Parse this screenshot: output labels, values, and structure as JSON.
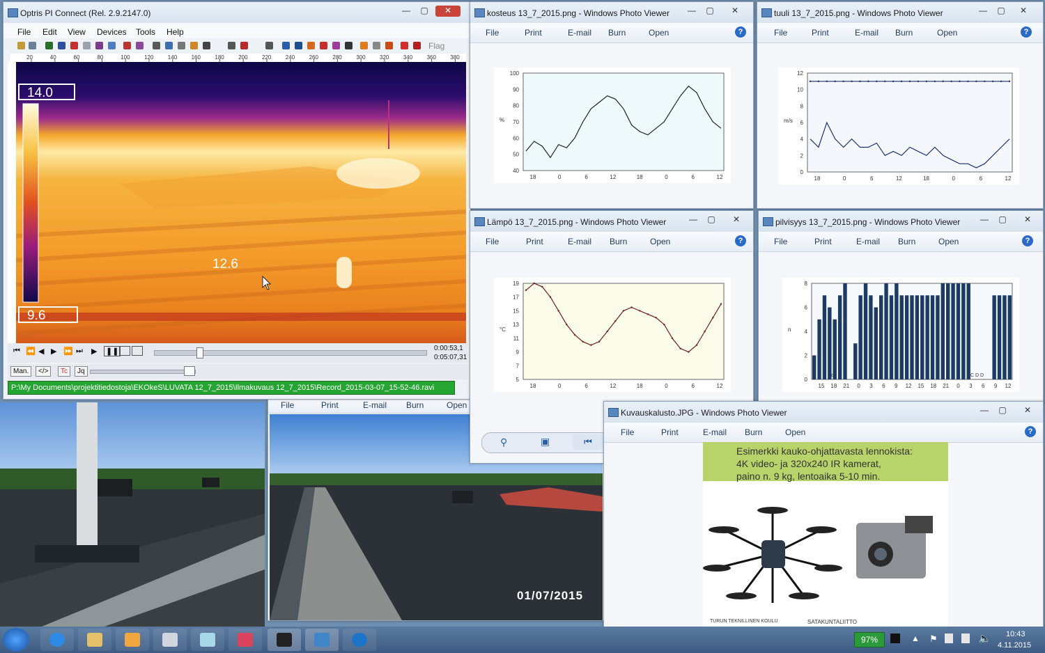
{
  "optris": {
    "title": "Optris PI Connect (Rel. 2.9.2147.0)",
    "menu": [
      "File",
      "Edit",
      "View",
      "Devices",
      "Tools",
      "Help"
    ],
    "flag_label": "Flag",
    "ruler_ticks": [
      "20",
      "40",
      "60",
      "80",
      "100",
      "120",
      "140",
      "160",
      "180",
      "200",
      "220",
      "240",
      "260",
      "280",
      "300",
      "320",
      "340",
      "360",
      "380"
    ],
    "scale_max": "14.0",
    "scale_min": "9.6",
    "spot_temp": "12.6",
    "time_current": "0:00:53,1",
    "time_total": "0:05:07,31",
    "mode_button": "Man.",
    "code_button": "</>",
    "tc_button": "Tc",
    "jq_button": "Jq",
    "status_path": "P:\\My Documents\\projektitiedostoja\\EKOkeS\\LUVATA 12_7_2015\\Ilmakuvaus 12_7_2015\\Record_2015-03-07_15-52-46.ravi"
  },
  "pv_menu": {
    "file": "File",
    "print": "Print",
    "email": "E-mail",
    "burn": "Burn",
    "open": "Open",
    "help": "?"
  },
  "windows": {
    "kosteus": {
      "title": "kosteus 13_7_2015.png - Windows Photo Viewer"
    },
    "tuuli": {
      "title": "tuuli 13_7_2015.png - Windows Photo Viewer"
    },
    "lampo": {
      "title": "Lämpö 13_7_2015.png - Windows Photo Viewer"
    },
    "pilvisyys": {
      "title": "pilvisyys 13_7_2015.png - Windows Photo Viewer"
    },
    "kuvaus": {
      "title": "Kuvauskalusto.JPG - Windows Photo Viewer"
    }
  },
  "chart_data": [
    {
      "type": "line",
      "ylabel": "%",
      "x_tick_labels": [
        "18",
        "0",
        "6",
        "12",
        "18",
        "0",
        "6",
        "12"
      ],
      "ylim": [
        40,
        100
      ],
      "y_ticks": [
        40,
        50,
        60,
        70,
        80,
        90,
        100
      ],
      "series": [
        {
          "values": [
            52,
            58,
            55,
            48,
            56,
            54,
            60,
            70,
            78,
            82,
            86,
            84,
            78,
            68,
            64,
            62,
            66,
            70,
            78,
            86,
            92,
            88,
            78,
            70,
            66
          ]
        }
      ]
    },
    {
      "type": "line",
      "ylabel": "m/s",
      "x_tick_labels": [
        "18",
        "0",
        "6",
        "12",
        "18",
        "0",
        "6",
        "12"
      ],
      "ylim": [
        0,
        12
      ],
      "y_ticks": [
        0,
        2,
        4,
        6,
        8,
        10,
        12
      ],
      "series": [
        {
          "values": [
            11,
            11,
            11,
            11,
            11,
            11,
            11,
            11,
            11,
            11,
            11,
            11,
            11,
            11,
            11,
            11,
            11,
            11,
            11,
            11,
            11,
            11,
            11,
            11,
            11
          ]
        },
        {
          "values": [
            4,
            3,
            6,
            4,
            3,
            4,
            3,
            3,
            3.5,
            2,
            2.5,
            2,
            3,
            2.5,
            2,
            3,
            2,
            1.5,
            1,
            1,
            0.5,
            1,
            2,
            3,
            4
          ]
        }
      ]
    },
    {
      "type": "line",
      "ylabel": "°C",
      "x_tick_labels": [
        "18",
        "0",
        "6",
        "12",
        "18",
        "0",
        "6",
        "12"
      ],
      "ylim": [
        5,
        19
      ],
      "y_ticks": [
        5,
        7,
        9,
        11,
        13,
        15,
        17,
        19
      ],
      "series": [
        {
          "values": [
            18,
            19,
            18.5,
            17,
            15,
            13,
            11.5,
            10.5,
            10,
            10.5,
            12,
            13.5,
            15,
            15.5,
            15,
            14.5,
            14,
            13,
            11,
            9.5,
            9,
            10,
            12,
            14,
            16
          ]
        }
      ]
    },
    {
      "type": "bar",
      "ylabel": "n",
      "x_tick_labels": [
        "15",
        "18",
        "21",
        "0",
        "3",
        "6",
        "9",
        "12",
        "15",
        "18",
        "21",
        "0",
        "3",
        "6",
        "9",
        "12"
      ],
      "ylim": [
        0,
        8
      ],
      "y_ticks": [
        0,
        2,
        4,
        6,
        8
      ],
      "values": [
        2,
        5,
        7,
        6,
        5,
        7,
        8,
        0,
        3,
        7,
        8,
        7,
        6,
        7,
        8,
        7,
        8,
        7,
        7,
        7,
        7,
        7,
        7,
        7,
        7,
        8,
        8,
        8,
        8,
        8,
        8,
        0,
        0,
        0,
        0,
        7,
        7,
        7,
        7
      ],
      "annotations": [
        "c",
        "C D D"
      ]
    }
  ],
  "kuvaus_image": {
    "caption_line1": "Esimerkki kauko-ohjattavasta lennokista:",
    "caption_line2": "4K video- ja 320x240 IR kamerat,",
    "caption_line3": "paino n. 9 kg, lentoaika 5-10 min.",
    "logo_left": "TURUN TEKNILLINEN KOULU",
    "logo_right": "SATAKUNTALIITTO"
  },
  "photo2": {
    "date_stamp": "01/07/2015"
  },
  "taskbar": {
    "battery": "97%",
    "time": "10:43",
    "date": "4.11.2015"
  }
}
